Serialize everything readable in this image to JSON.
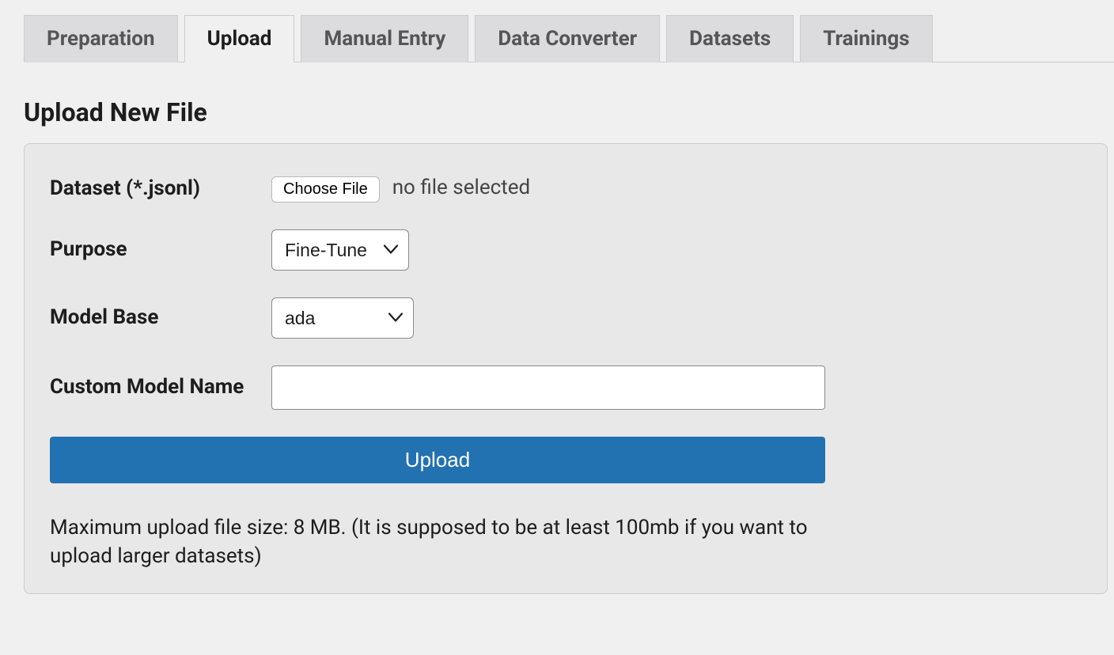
{
  "tabs": [
    {
      "label": "Preparation",
      "active": false
    },
    {
      "label": "Upload",
      "active": true
    },
    {
      "label": "Manual Entry",
      "active": false
    },
    {
      "label": "Data Converter",
      "active": false
    },
    {
      "label": "Datasets",
      "active": false
    },
    {
      "label": "Trainings",
      "active": false
    }
  ],
  "section": {
    "title": "Upload New File"
  },
  "form": {
    "dataset": {
      "label": "Dataset (*.jsonl)",
      "choose_label": "Choose File",
      "status": "no file selected"
    },
    "purpose": {
      "label": "Purpose",
      "selected": "Fine-Tune"
    },
    "model_base": {
      "label": "Model Base",
      "selected": "ada"
    },
    "custom_model": {
      "label": "Custom Model Name",
      "value": ""
    },
    "submit_label": "Upload",
    "note": "Maximum upload file size: 8 MB. (It is supposed to be at least 100mb if you want to upload larger datasets)"
  }
}
